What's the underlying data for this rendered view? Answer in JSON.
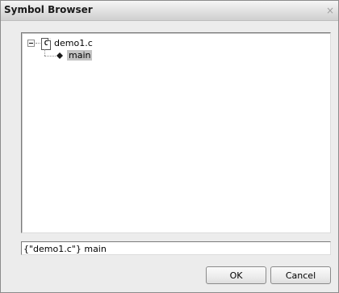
{
  "window": {
    "title": "Symbol Browser",
    "close_glyph": "×"
  },
  "tree": {
    "file_node": {
      "label": "demo1.c",
      "icon_letter": "C",
      "icon": "c-source-file-icon",
      "expanded": true
    },
    "children": [
      {
        "label": "main",
        "icon": "function-icon",
        "selected": true
      }
    ]
  },
  "status": {
    "text": "{\"demo1.c\"} main"
  },
  "buttons": {
    "ok": "OK",
    "cancel": "Cancel"
  }
}
